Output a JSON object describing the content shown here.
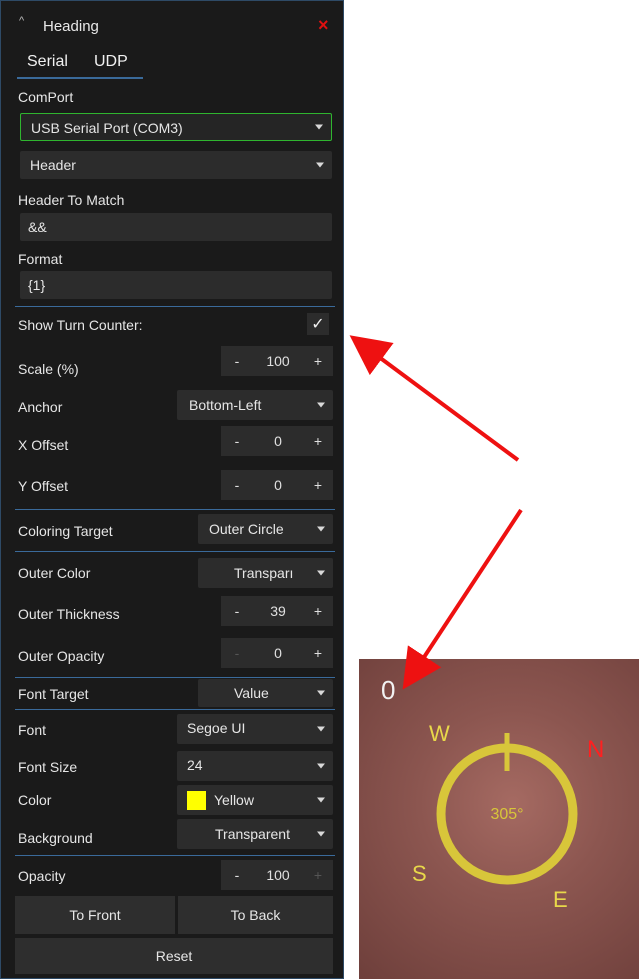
{
  "panel": {
    "title": "Heading",
    "tabs": [
      "Serial",
      "UDP"
    ],
    "comport_label": "ComPort",
    "comport_value": "USB Serial Port (COM3)",
    "match_mode_value": "Header",
    "header_to_match_label": "Header To Match",
    "header_to_match_value": "&&",
    "format_label": "Format",
    "format_value": "{1}",
    "show_turn_counter_label": "Show Turn Counter:",
    "scale_label": "Scale (%)",
    "scale_value": "100",
    "anchor_label": "Anchor",
    "anchor_value": "Bottom-Left",
    "x_offset_label": "X Offset",
    "x_offset_value": "0",
    "y_offset_label": "Y Offset",
    "y_offset_value": "0",
    "coloring_target_label": "Coloring Target",
    "coloring_target_value": "Outer Circle",
    "outer_color_label": "Outer Color",
    "outer_color_value": "Transparı",
    "outer_thickness_label": "Outer Thickness",
    "outer_thickness_value": "39",
    "outer_opacity_label": "Outer Opacity",
    "outer_opacity_value": "0",
    "font_target_label": "Font Target",
    "font_target_value": "Value",
    "font_label": "Font",
    "font_value": "Segoe UI",
    "font_size_label": "Font Size",
    "font_size_value": "24",
    "color_label": "Color",
    "color_value": "Yellow",
    "background_label": "Background",
    "background_value": "Transparent",
    "opacity_label": "Opacity",
    "opacity_value": "100",
    "to_front_label": "To Front",
    "to_back_label": "To Back",
    "reset_label": "Reset",
    "minus": "-",
    "plus": "+",
    "close_glyph": "×",
    "collapse_glyph": "^",
    "checkmark": "✓"
  },
  "preview": {
    "turn_counter": "0",
    "heading_value": "305°",
    "compass": {
      "w": "W",
      "s": "S",
      "e": "E",
      "n": "N"
    }
  },
  "colors": {
    "accent_green": "#2fb52f",
    "panel_bg": "#1a1a1a",
    "yellow": "#ffff00",
    "arrow_red": "#ee1111"
  }
}
